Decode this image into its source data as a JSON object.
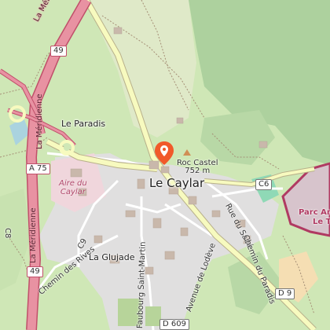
{
  "map": {
    "places": {
      "town": "Le Caylar",
      "paradis": "Le Paradis",
      "glujade": "La Glujade"
    },
    "peak": {
      "name": "Roc Castel",
      "elevation": "752 m"
    },
    "aire": {
      "line1": "Aire du",
      "line2": "Caylar"
    },
    "park": {
      "line1": "Parc Ani",
      "line2": "Le Th"
    },
    "roads": {
      "meridienne_top": "La Méridienne",
      "meridienne_bottom": "La Méridienne",
      "chemin_rives": "Chemin des Rives",
      "faubourg": "Faubourg Saint-Martin",
      "lodeve": "Avenue de Lodève",
      "sabe": "Rue du Sabé",
      "chemin_paradis": "Chemin du Paradis",
      "c9": "C9",
      "c8": "C8"
    },
    "refs": {
      "a49_top": "49",
      "a75": "A 75",
      "a49_bottom": "49",
      "c6": "C6",
      "d9": "D 9",
      "d609": "D 609"
    },
    "icons": [
      "map-marker-icon",
      "peak-icon",
      "tree-icon"
    ],
    "colors": {
      "background": "#cfe7b6",
      "forest": "#add19e",
      "motorway": "#e892a2",
      "residential": "#e0dfdf",
      "marker": "#f1592a",
      "park_border": "#b03a62",
      "main_road": "#f7fabf"
    }
  }
}
